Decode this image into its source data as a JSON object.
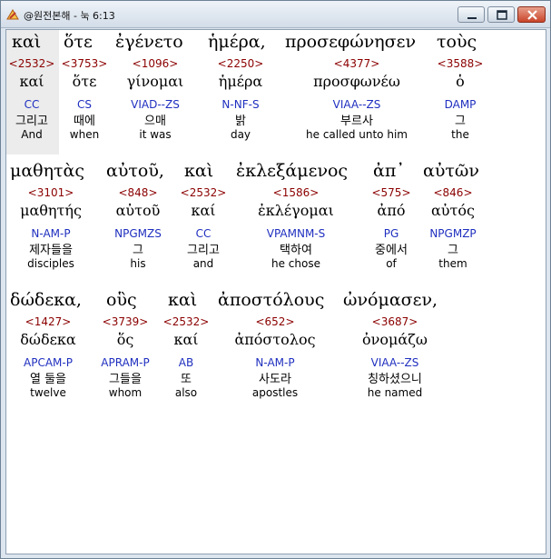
{
  "window": {
    "title": "@원전본해 - 눅 6:13",
    "controls": {
      "minimize": "minimize",
      "maximize": "maximize",
      "close": "close"
    }
  },
  "lines": [
    {
      "greek": [
        "καὶ",
        "ὅτε",
        "ἐγένετο",
        "ἡμέρα,",
        "προσεφώνησεν",
        "τοὺς"
      ],
      "words": [
        {
          "num": "<2532>",
          "lemma": "καί",
          "parse": "CC",
          "korean": "그리고",
          "english": "And"
        },
        {
          "num": "<3753>",
          "lemma": "ὅτε",
          "parse": "CS",
          "korean": "때에",
          "english": "when"
        },
        {
          "num": "<1096>",
          "lemma": "γίνομαι",
          "parse": "VIAD--ZS",
          "korean": "으매",
          "english": "it was"
        },
        {
          "num": "<2250>",
          "lemma": "ἡμέρα",
          "parse": "N-NF-S",
          "korean": "밝",
          "english": "day"
        },
        {
          "num": "<4377>",
          "lemma": "προσφωνέω",
          "parse": "VIAA--ZS",
          "korean": "부르사",
          "english": "he called unto him"
        },
        {
          "num": "<3588>",
          "lemma": "ὁ",
          "parse": "DAMP",
          "korean": "그",
          "english": "the"
        }
      ]
    },
    {
      "greek": [
        "μαθητὰς",
        "αὐτοῦ,",
        "καὶ",
        "ἐκλεξάμενος",
        "ἀπ᾽",
        "αὐτῶν"
      ],
      "words": [
        {
          "num": "<3101>",
          "lemma": "μαθητής",
          "parse": "N-AM-P",
          "korean": "제자들을",
          "english": "disciples"
        },
        {
          "num": "<848>",
          "lemma": "αὐτοῦ",
          "parse": "NPGMZS",
          "korean": "그",
          "english": "his"
        },
        {
          "num": "<2532>",
          "lemma": "καί",
          "parse": "CC",
          "korean": "그리고",
          "english": "and"
        },
        {
          "num": "<1586>",
          "lemma": "ἐκλέγομαι",
          "parse": "VPAMNM-S",
          "korean": "택하여",
          "english": "he chose"
        },
        {
          "num": "<575>",
          "lemma": "ἀπό",
          "parse": "PG",
          "korean": "중에서",
          "english": "of"
        },
        {
          "num": "<846>",
          "lemma": "αὐτός",
          "parse": "NPGMZP",
          "korean": "그",
          "english": "them"
        }
      ]
    },
    {
      "greek": [
        "δώδεκα,",
        "οὓς",
        "καὶ",
        "ἀποστόλους",
        "ὠνόμασεν,"
      ],
      "words": [
        {
          "num": "<1427>",
          "lemma": "δώδεκα",
          "parse": "APCAM-P",
          "korean": "열 둘을",
          "english": "twelve"
        },
        {
          "num": "<3739>",
          "lemma": "ὅς",
          "parse": "APRAM-P",
          "korean": "그들을",
          "english": "whom"
        },
        {
          "num": "<2532>",
          "lemma": "καί",
          "parse": "AB",
          "korean": "또",
          "english": "also"
        },
        {
          "num": "<652>",
          "lemma": "ἀπόστολος",
          "parse": "N-AM-P",
          "korean": "사도라",
          "english": "apostles"
        },
        {
          "num": "<3687>",
          "lemma": "ὀνομάζω",
          "parse": "VIAA--ZS",
          "korean": "칭하셨으니",
          "english": "he named"
        }
      ]
    }
  ]
}
